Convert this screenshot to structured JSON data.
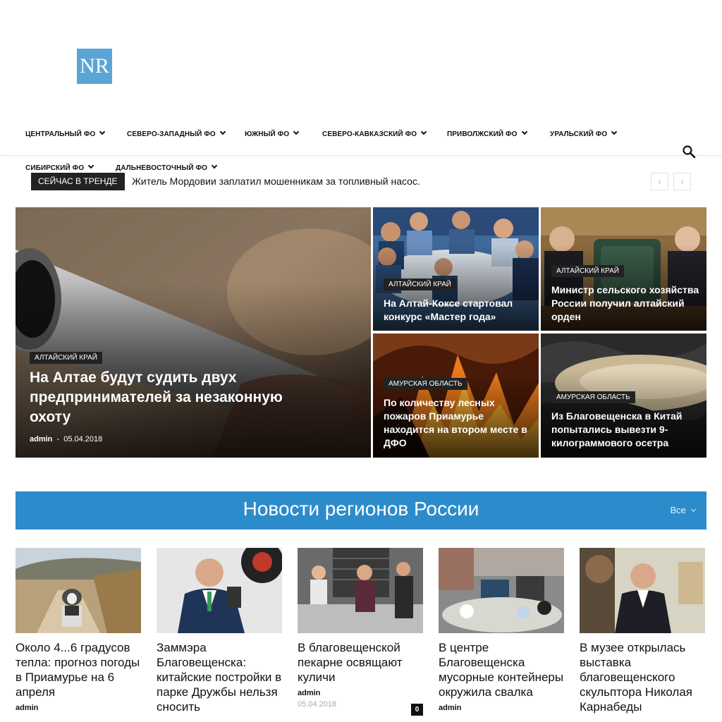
{
  "header": {
    "logo_text": "NR"
  },
  "nav": {
    "items": [
      {
        "label": "Центральный ФО"
      },
      {
        "label": "Северо-Западный ФО"
      },
      {
        "label": "Южный ФО"
      },
      {
        "label": "Северо-Кавказский ФО"
      },
      {
        "label": "Приволжский ФО"
      },
      {
        "label": "Уральский ФО"
      },
      {
        "label": "Сибирский ФО"
      },
      {
        "label": "Дальневосточный ФО"
      }
    ],
    "search_icon": "search-icon"
  },
  "trending": {
    "badge": "СЕЙЧАС В ТРЕНДЕ",
    "headline": "Житель Мордовии заплатил мошенникам за топливный насос.",
    "prev_icon": "‹",
    "next_icon": "›"
  },
  "featured": [
    {
      "category": "Алтайский край",
      "title": "На Алтае будут судить двух предпринимателей за незаконную охоту",
      "author": "admin",
      "separator": "-",
      "date": "05.04.2018"
    },
    {
      "category": "Алтайский край",
      "title": "На Алтай-Коксе стартовал конкурс «Мастер года»"
    },
    {
      "category": "Алтайский край",
      "title": "Министр сельского хозяйства России получил алтайский орден"
    },
    {
      "category": "Амурская область",
      "title": "По количеству лесных пожаров Приамурье находится на втором месте в ДФО"
    },
    {
      "category": "Амурская область",
      "title": "Из Благовещенска в Китай попытались вывезти 9-килограммового осетра"
    }
  ],
  "section": {
    "title": "Новости регионов России",
    "all_label": "Все",
    "accent": "#2c8ccb"
  },
  "cards": [
    {
      "title": "Около 4...6 градусов тепла: прогноз погоды в Приамурье на 6 апреля",
      "author": "admin"
    },
    {
      "title": "Заммэра Благовещенска: китайские постройки в парке Дружбы нельзя сносить"
    },
    {
      "title": "В благовещенской пекарне освящают куличи",
      "author": "admin",
      "date": "05.04.2018",
      "comments": "0"
    },
    {
      "title": "В центре Благовещенска мусорные контейнеры окружила свалка",
      "author": "admin"
    },
    {
      "title": "В музее открылась выставка благовещенского скульптора Николая Карнабеды"
    }
  ]
}
